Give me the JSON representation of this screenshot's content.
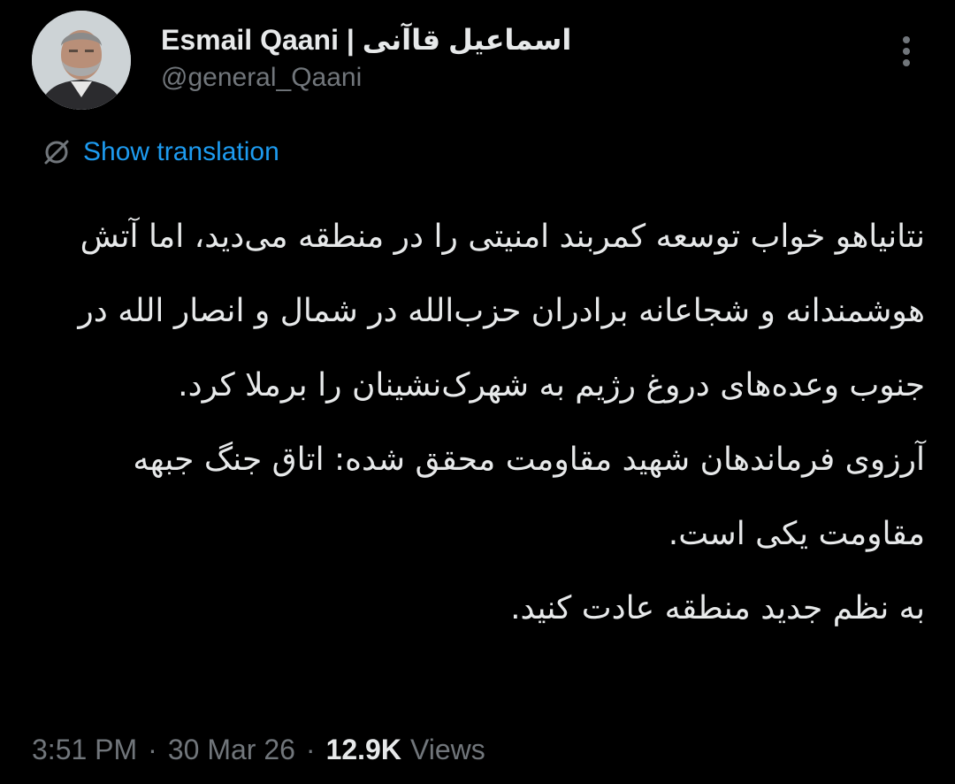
{
  "author": {
    "display_name": "Esmail Qaani | اسماعیل قاآنی",
    "handle": "@general_Qaani"
  },
  "translate": {
    "label": "Show translation",
    "icon": "translate-globe-icon"
  },
  "more": {
    "icon": "more-vertical-icon"
  },
  "tweet": {
    "paragraphs": [
      "نتانیاهو خواب توسعه کمربند امنیتی را در منطقه می‌دید، اما آتش هوشمندانه و شجاعانه برادران حزب‌الله در شمال و انصار الله در جنوب وعده‌های دروغ رژیم به شهرک‌نشینان را برملا کرد.",
      "آرزوی فرماندهان شهید مقاومت محقق شده: اتاق جنگ جبهه مقاومت یکی است.",
      "به نظم جدید منطقه عادت کنید."
    ]
  },
  "meta": {
    "time": "3:51 PM",
    "separator": "·",
    "date": "30 Mar 26",
    "views_count": "12.9K",
    "views_label": "Views"
  },
  "colors": {
    "background": "#000000",
    "text_primary": "#e7e9ea",
    "text_secondary": "#71767b",
    "accent": "#1d9bf0"
  }
}
